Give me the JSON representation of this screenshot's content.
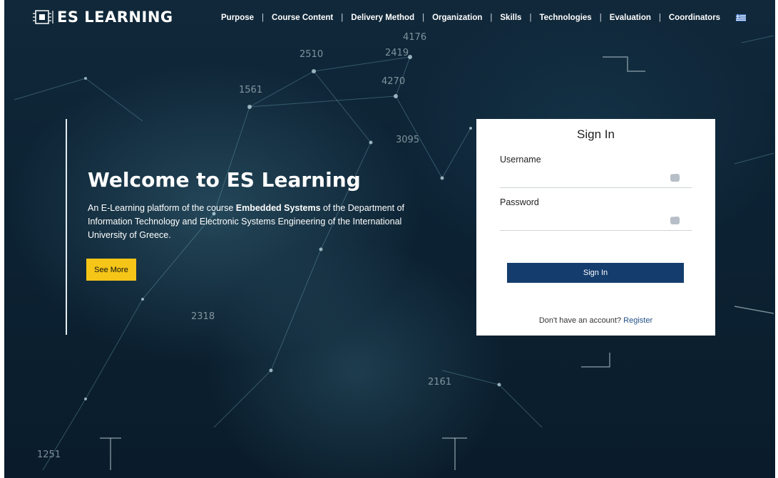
{
  "header": {
    "logo_text": "ES LEARNING",
    "nav": [
      {
        "label": "Purpose"
      },
      {
        "label": "Course Content"
      },
      {
        "label": "Delivery Method"
      },
      {
        "label": "Organization"
      },
      {
        "label": "Skills"
      },
      {
        "label": "Technologies"
      },
      {
        "label": "Evaluation"
      },
      {
        "label": "Coordinators"
      }
    ],
    "nav_separator": "|",
    "language_icon": "greek-flag-icon"
  },
  "hero": {
    "title": "Welcome to ES Learning",
    "desc_pre": "An E-Learning platform of the course ",
    "desc_bold": "Embedded Systems",
    "desc_post": " of the Department of Information Technology and Electronic Systems Engineering of the International University of Greece.",
    "see_more_label": "See More"
  },
  "background_numbers": [
    "4176",
    "2510",
    "2419",
    "4270",
    "1561",
    "3095",
    "2318",
    "2161",
    "1251"
  ],
  "signin": {
    "title": "Sign In",
    "username_label": "Username",
    "username_value": "",
    "password_label": "Password",
    "password_value": "",
    "button_label": "Sign In",
    "register_prompt": "Don't have an account?",
    "register_link": "Register"
  },
  "colors": {
    "accent_yellow": "#f5c518",
    "button_blue": "#143d6e",
    "link_blue": "#1f4f86",
    "background_dark": "#0c2233"
  }
}
